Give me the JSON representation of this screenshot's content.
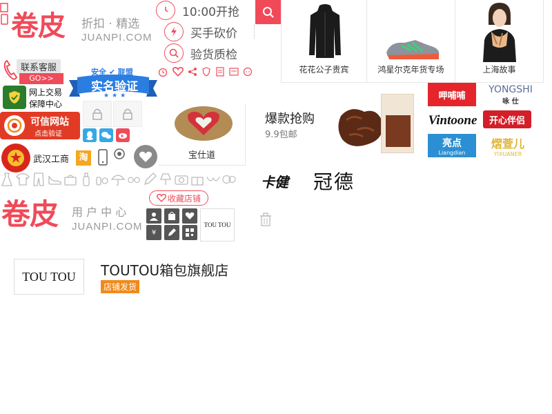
{
  "header": {
    "logo_cn": "卷皮",
    "logo_sub": "折扣 · 精选",
    "logo_en": "JUANPI.COM",
    "features": [
      {
        "icon": "clock-icon",
        "label": "10:00开抢"
      },
      {
        "icon": "lightning-icon",
        "label": "买手砍价"
      },
      {
        "icon": "magnifier-icon",
        "label": "验货质检"
      }
    ],
    "search_icon": "search-icon"
  },
  "brand_cards": [
    {
      "label": "花花公子贵宾",
      "image": "black-jacket"
    },
    {
      "label": "鸿星尔克年货专场",
      "image": "sneaker"
    },
    {
      "label": "上海故事",
      "image": "model-scarf"
    }
  ],
  "service": {
    "contact_label": "联系客服",
    "go_label": "GO>>",
    "trade_guarantee": [
      "网上交易",
      "保障中心"
    ],
    "verify_line1": "安全",
    "verify_line2": "联盟",
    "verify_main": "实名验证",
    "trusted_site": "可信网站",
    "trusted_sub": "点击验证",
    "wuhan_ic": "武汉工商",
    "taobao_badge": "淘"
  },
  "promo": {
    "title": "爆款抢购",
    "price": "9.9包邮"
  },
  "brand_logos": [
    {
      "name": "呷哺哺",
      "color": "#e4262c"
    },
    {
      "name": "YONGSHI",
      "sub": "咏 仕",
      "color": "#5b6c9b"
    },
    {
      "name": "Vintoone",
      "color": "#111111"
    },
    {
      "name": "开心伴侣",
      "color": "#d21f2a"
    },
    {
      "name": "亮点",
      "sub": "Liangdian",
      "color": "#2c8fd3"
    },
    {
      "name": "熠萱儿",
      "sub": "YIXUANER",
      "color": "#e1b53a"
    }
  ],
  "second_logos": [
    "卡健",
    "冠德"
  ],
  "store_item": {
    "label": "宝仕道"
  },
  "favorite_label": "收藏店铺",
  "toutou_logo": "TOU TOU",
  "footer_logo": {
    "logo_cn": "卷皮",
    "logo_sub": "用 户 中 心",
    "logo_en": "JUANPI.COM"
  },
  "store": {
    "logo": "TOU TOU",
    "name": "TOUTOU箱包旗舰店",
    "badge": "店铺发货"
  }
}
